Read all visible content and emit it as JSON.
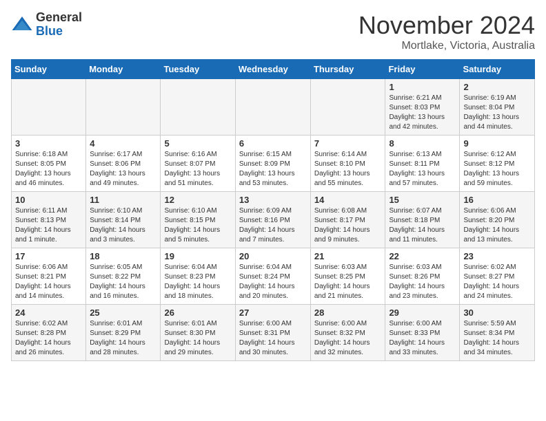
{
  "header": {
    "logo_general": "General",
    "logo_blue": "Blue",
    "month_title": "November 2024",
    "location": "Mortlake, Victoria, Australia"
  },
  "days_of_week": [
    "Sunday",
    "Monday",
    "Tuesday",
    "Wednesday",
    "Thursday",
    "Friday",
    "Saturday"
  ],
  "weeks": [
    [
      null,
      null,
      null,
      null,
      null,
      {
        "day": "1",
        "sunrise": "6:21 AM",
        "sunset": "8:03 PM",
        "daylight": "13 hours and 42 minutes."
      },
      {
        "day": "2",
        "sunrise": "6:19 AM",
        "sunset": "8:04 PM",
        "daylight": "13 hours and 44 minutes."
      }
    ],
    [
      {
        "day": "3",
        "sunrise": "6:18 AM",
        "sunset": "8:05 PM",
        "daylight": "13 hours and 46 minutes."
      },
      {
        "day": "4",
        "sunrise": "6:17 AM",
        "sunset": "8:06 PM",
        "daylight": "13 hours and 49 minutes."
      },
      {
        "day": "5",
        "sunrise": "6:16 AM",
        "sunset": "8:07 PM",
        "daylight": "13 hours and 51 minutes."
      },
      {
        "day": "6",
        "sunrise": "6:15 AM",
        "sunset": "8:09 PM",
        "daylight": "13 hours and 53 minutes."
      },
      {
        "day": "7",
        "sunrise": "6:14 AM",
        "sunset": "8:10 PM",
        "daylight": "13 hours and 55 minutes."
      },
      {
        "day": "8",
        "sunrise": "6:13 AM",
        "sunset": "8:11 PM",
        "daylight": "13 hours and 57 minutes."
      },
      {
        "day": "9",
        "sunrise": "6:12 AM",
        "sunset": "8:12 PM",
        "daylight": "13 hours and 59 minutes."
      }
    ],
    [
      {
        "day": "10",
        "sunrise": "6:11 AM",
        "sunset": "8:13 PM",
        "daylight": "14 hours and 1 minute."
      },
      {
        "day": "11",
        "sunrise": "6:10 AM",
        "sunset": "8:14 PM",
        "daylight": "14 hours and 3 minutes."
      },
      {
        "day": "12",
        "sunrise": "6:10 AM",
        "sunset": "8:15 PM",
        "daylight": "14 hours and 5 minutes."
      },
      {
        "day": "13",
        "sunrise": "6:09 AM",
        "sunset": "8:16 PM",
        "daylight": "14 hours and 7 minutes."
      },
      {
        "day": "14",
        "sunrise": "6:08 AM",
        "sunset": "8:17 PM",
        "daylight": "14 hours and 9 minutes."
      },
      {
        "day": "15",
        "sunrise": "6:07 AM",
        "sunset": "8:18 PM",
        "daylight": "14 hours and 11 minutes."
      },
      {
        "day": "16",
        "sunrise": "6:06 AM",
        "sunset": "8:20 PM",
        "daylight": "14 hours and 13 minutes."
      }
    ],
    [
      {
        "day": "17",
        "sunrise": "6:06 AM",
        "sunset": "8:21 PM",
        "daylight": "14 hours and 14 minutes."
      },
      {
        "day": "18",
        "sunrise": "6:05 AM",
        "sunset": "8:22 PM",
        "daylight": "14 hours and 16 minutes."
      },
      {
        "day": "19",
        "sunrise": "6:04 AM",
        "sunset": "8:23 PM",
        "daylight": "14 hours and 18 minutes."
      },
      {
        "day": "20",
        "sunrise": "6:04 AM",
        "sunset": "8:24 PM",
        "daylight": "14 hours and 20 minutes."
      },
      {
        "day": "21",
        "sunrise": "6:03 AM",
        "sunset": "8:25 PM",
        "daylight": "14 hours and 21 minutes."
      },
      {
        "day": "22",
        "sunrise": "6:03 AM",
        "sunset": "8:26 PM",
        "daylight": "14 hours and 23 minutes."
      },
      {
        "day": "23",
        "sunrise": "6:02 AM",
        "sunset": "8:27 PM",
        "daylight": "14 hours and 24 minutes."
      }
    ],
    [
      {
        "day": "24",
        "sunrise": "6:02 AM",
        "sunset": "8:28 PM",
        "daylight": "14 hours and 26 minutes."
      },
      {
        "day": "25",
        "sunrise": "6:01 AM",
        "sunset": "8:29 PM",
        "daylight": "14 hours and 28 minutes."
      },
      {
        "day": "26",
        "sunrise": "6:01 AM",
        "sunset": "8:30 PM",
        "daylight": "14 hours and 29 minutes."
      },
      {
        "day": "27",
        "sunrise": "6:00 AM",
        "sunset": "8:31 PM",
        "daylight": "14 hours and 30 minutes."
      },
      {
        "day": "28",
        "sunrise": "6:00 AM",
        "sunset": "8:32 PM",
        "daylight": "14 hours and 32 minutes."
      },
      {
        "day": "29",
        "sunrise": "6:00 AM",
        "sunset": "8:33 PM",
        "daylight": "14 hours and 33 minutes."
      },
      {
        "day": "30",
        "sunrise": "5:59 AM",
        "sunset": "8:34 PM",
        "daylight": "14 hours and 34 minutes."
      }
    ]
  ]
}
